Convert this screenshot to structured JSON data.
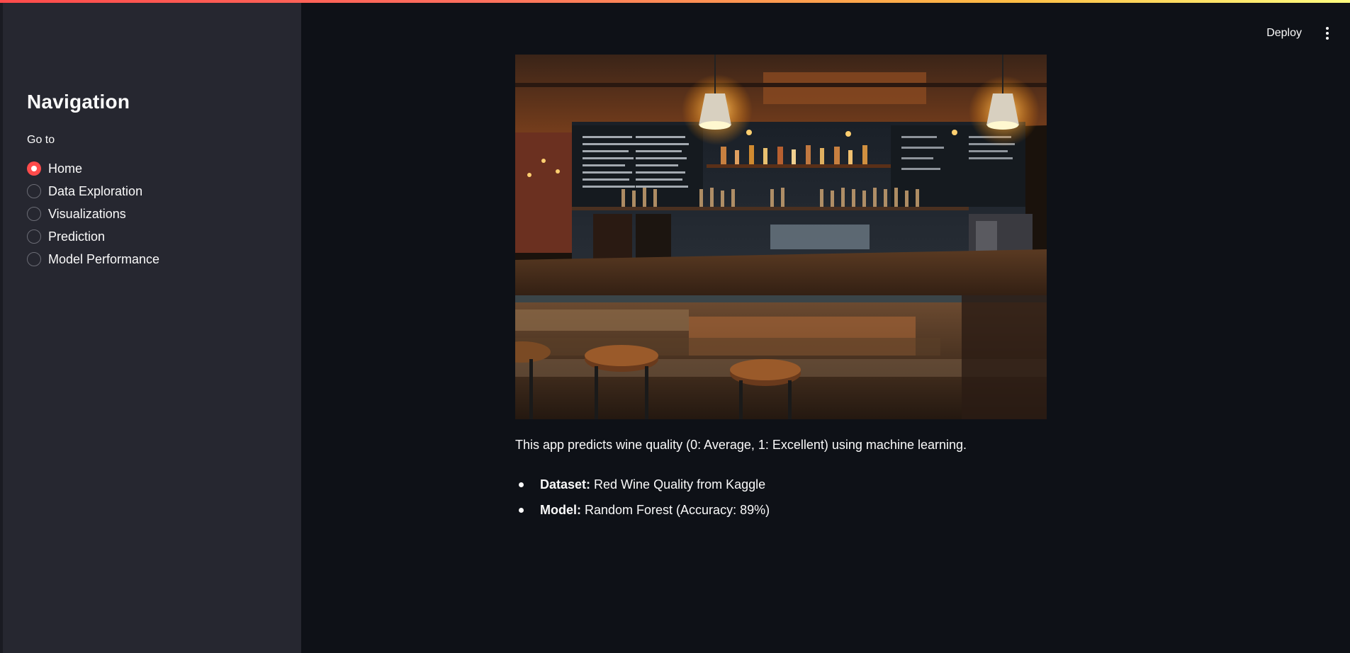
{
  "header": {
    "deploy_label": "Deploy",
    "menu_icon": "more-vertical-icon"
  },
  "sidebar": {
    "title": "Navigation",
    "radio_label": "Go to",
    "selected": "Home",
    "options": [
      {
        "label": "Home",
        "selected": true
      },
      {
        "label": "Data Exploration",
        "selected": false
      },
      {
        "label": "Visualizations",
        "selected": false
      },
      {
        "label": "Prediction",
        "selected": false
      },
      {
        "label": "Model Performance",
        "selected": false
      }
    ]
  },
  "main": {
    "intro": "This app predicts wine quality (0: Average, 1: Excellent) using machine learning.",
    "bullets": [
      {
        "key": "Dataset:",
        "value": "Red Wine Quality from Kaggle"
      },
      {
        "key": "Model:",
        "value": "Random Forest (Accuracy: 89%)"
      }
    ]
  },
  "colors": {
    "accent": "#ff4b4b",
    "sidebar_bg": "#262730",
    "main_bg": "#0e1117",
    "text": "#fafafa"
  }
}
